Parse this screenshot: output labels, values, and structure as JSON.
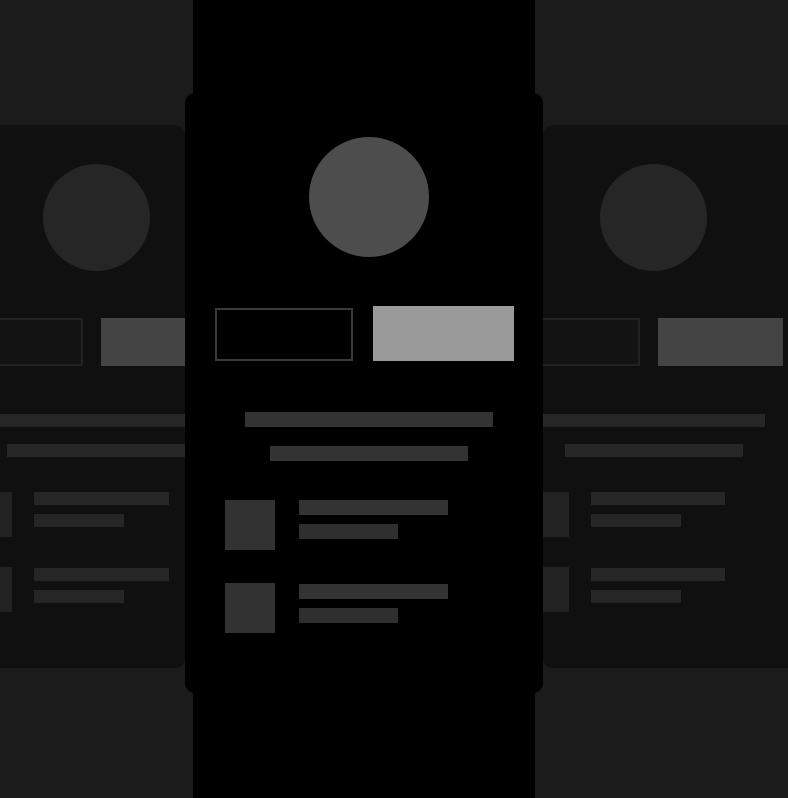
{
  "screen": {
    "description_title": "",
    "cards": [
      {
        "position": "left",
        "buttons": {
          "secondary_label": "",
          "primary_label": ""
        },
        "list": [
          {
            "title": "",
            "subtitle": ""
          },
          {
            "title": "",
            "subtitle": ""
          }
        ]
      },
      {
        "position": "center",
        "buttons": {
          "secondary_label": "",
          "primary_label": ""
        },
        "heading": "",
        "subheading": "",
        "list": [
          {
            "title": "",
            "subtitle": ""
          },
          {
            "title": "",
            "subtitle": ""
          }
        ]
      },
      {
        "position": "right",
        "buttons": {
          "secondary_label": "",
          "primary_label": ""
        },
        "list": [
          {
            "title": "",
            "subtitle": ""
          },
          {
            "title": "",
            "subtitle": ""
          }
        ]
      }
    ]
  },
  "colors": {
    "background": "#1b1b1b",
    "center_column": "#000000",
    "side_card": "#101010",
    "avatar_center": "#4d4d4d",
    "primary_button_center": "#9a9a9a",
    "skeleton_line": "#333333"
  }
}
